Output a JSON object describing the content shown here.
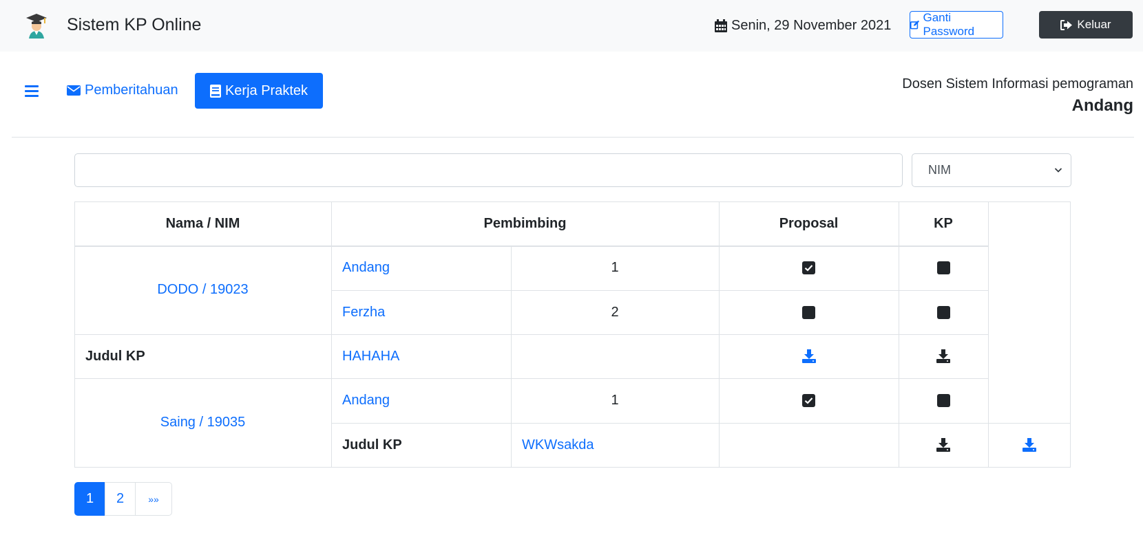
{
  "header": {
    "app_title": "Sistem KP Online",
    "date": "Senin, 29 November 2021",
    "change_password_label": "Ganti Password",
    "logout_label": "Keluar"
  },
  "nav": {
    "notifications_label": "Pemberitahuan",
    "kp_label": "Kerja Praktek"
  },
  "user": {
    "role": "Dosen Sistem Informasi pemograman",
    "name": "Andang"
  },
  "search": {
    "query": "",
    "filter_selected": "NIM"
  },
  "table": {
    "headers": [
      "Nama / NIM",
      "Pembimbing",
      "Proposal",
      "KP"
    ],
    "students": [
      {
        "name_nim": "DODO / 19023",
        "advisors": [
          {
            "name": "Andang",
            "order": "1",
            "proposal_checked": true,
            "kp_checked": false
          },
          {
            "name": "Ferzha",
            "order": "2",
            "proposal_checked": false,
            "kp_checked": false
          }
        ],
        "title_label": "Judul KP",
        "title": "HAHAHA"
      },
      {
        "name_nim": "Saing / 19035",
        "advisors": [
          {
            "name": "Andang",
            "order": "1",
            "proposal_checked": true,
            "kp_checked": false
          }
        ],
        "title_label": "Judul KP",
        "title": "WKWsakda"
      }
    ]
  },
  "pagination": {
    "pages": [
      "1",
      "2"
    ],
    "next_label": "»»",
    "current": "1"
  },
  "colors": {
    "primary": "#0d6efd",
    "dark": "#343a40",
    "header_bg": "#f8f9fa"
  }
}
